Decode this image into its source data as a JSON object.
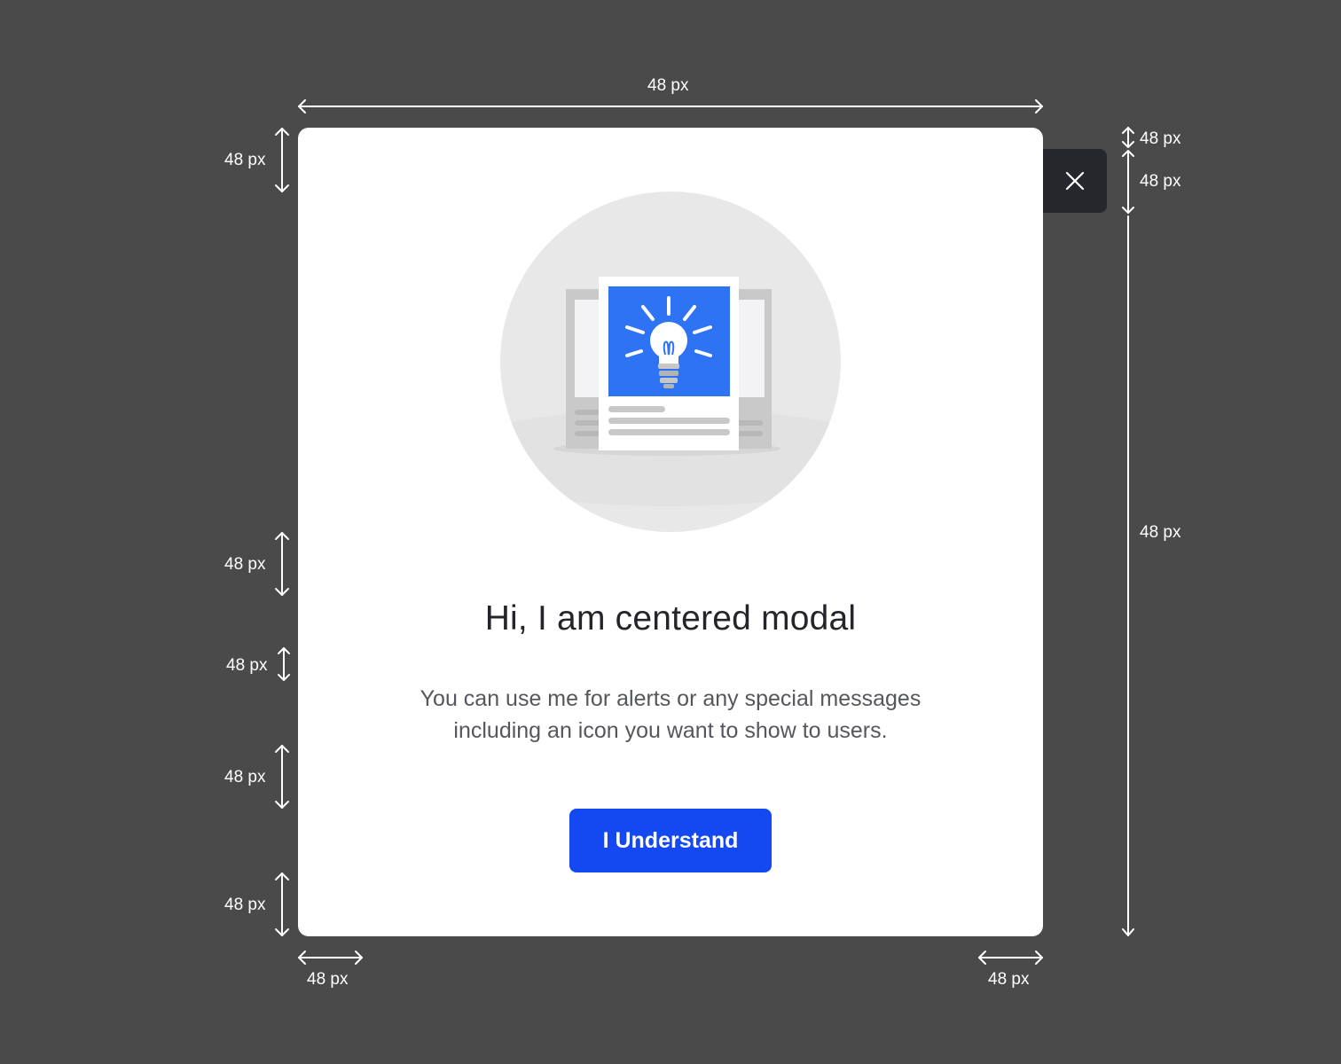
{
  "modal": {
    "title": "Hi, I am centered modal",
    "body_lines": [
      "You can use me for alerts or any special messages",
      "including an icon you want to show to users."
    ],
    "primary_button_label": "I Understand",
    "close_icon": "close-icon",
    "illustration_icon": "lightbulb-icon"
  },
  "annotations": {
    "top_width": "48 px",
    "left_top_padding": "48 px",
    "left_illustration_gap": "48 px",
    "left_title_gap": "48 px",
    "left_text_gap": "48 px",
    "left_bottom_padding": "48 px",
    "right_close_offset": "48 px",
    "right_close_height": "48 px",
    "right_modal_height": "48 px",
    "bottom_left_padding": "48 px",
    "bottom_right_padding": "48 px"
  },
  "colors": {
    "backdrop": "#4a4a4a",
    "modal_bg": "#ffffff",
    "primary": "#1448f0",
    "close_bg": "#25272c",
    "title": "#23252b",
    "body": "#55575d",
    "illustration_accent": "#2f73f5"
  }
}
